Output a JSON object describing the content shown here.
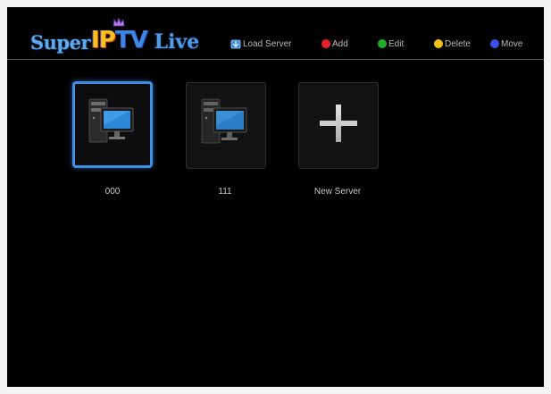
{
  "header": {
    "logo": {
      "part1": "Super",
      "part2a": "IP",
      "part2b": "TV",
      "part3": "Live"
    },
    "legend": [
      {
        "icon": "load-server-icon",
        "label": "Load Server",
        "color": "#3d8fe6"
      },
      {
        "icon": "red-button-icon",
        "label": "Add",
        "color": "#e8202a"
      },
      {
        "icon": "green-button-icon",
        "label": "Edit",
        "color": "#1fae2b"
      },
      {
        "icon": "yellow-button-icon",
        "label": "Delete",
        "color": "#f2c21a"
      },
      {
        "icon": "blue-button-icon",
        "label": "Move",
        "color": "#3a4fe8"
      }
    ]
  },
  "servers": [
    {
      "name": "000",
      "icon": "computer-icon",
      "selected": true
    },
    {
      "name": "111",
      "icon": "computer-icon",
      "selected": false
    },
    {
      "name": "New Server",
      "icon": "plus-icon",
      "selected": false
    }
  ],
  "colors": {
    "selection": "#3d8fe6",
    "background": "#000000"
  }
}
